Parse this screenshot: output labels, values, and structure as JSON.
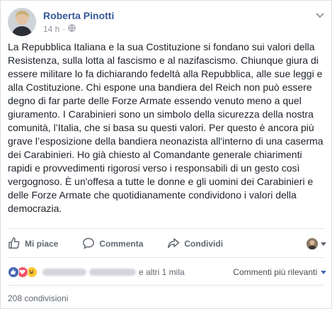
{
  "post": {
    "author": "Roberta Pinotti",
    "time": "14 h",
    "separator": "·",
    "body": "La Repubblica Italiana e la sua Costituzione si fondano sui valori della Resistenza, sulla lotta al fascismo e al nazifascismo. Chiunque giura di essere militare lo fa dichiarando fedeltà alla Repubblica, alle sue leggi e alla Costituzione. Chi espone una bandiera del Reich non può essere degno di far parte delle Forze Armate essendo venuto meno a quel giuramento. I Carabinieri sono un simbolo della sicurezza della nostra comunità, l’Italia, che si basa su questi valori. Per questo è ancora più grave l’esposizione della bandiera neonazista all'interno di una caserma dei Carabinieri. Ho già chiesto al Comandante generale chiarimenti rapidi e provvedimenti rigorosi verso i responsabili di un gesto così vergognoso. È un'offesa a tutte le donne e gli uomini dei Carabinieri e delle Forze Armate che quotidianamente condividono i valori della democrazia."
  },
  "actions": {
    "like": "Mi piace",
    "comment": "Commenta",
    "share": "Condividi"
  },
  "reactions": {
    "others": "e altri 1 mila",
    "sort_label": "Commenti più rilevanti",
    "icons": [
      "like-icon",
      "love-icon",
      "haha-icon"
    ]
  },
  "shares": "208 condivisioni",
  "colors": {
    "link": "#365899",
    "like_blue": "#4267b2",
    "love_red": "#f25268",
    "haha_yellow": "#fcc937"
  }
}
